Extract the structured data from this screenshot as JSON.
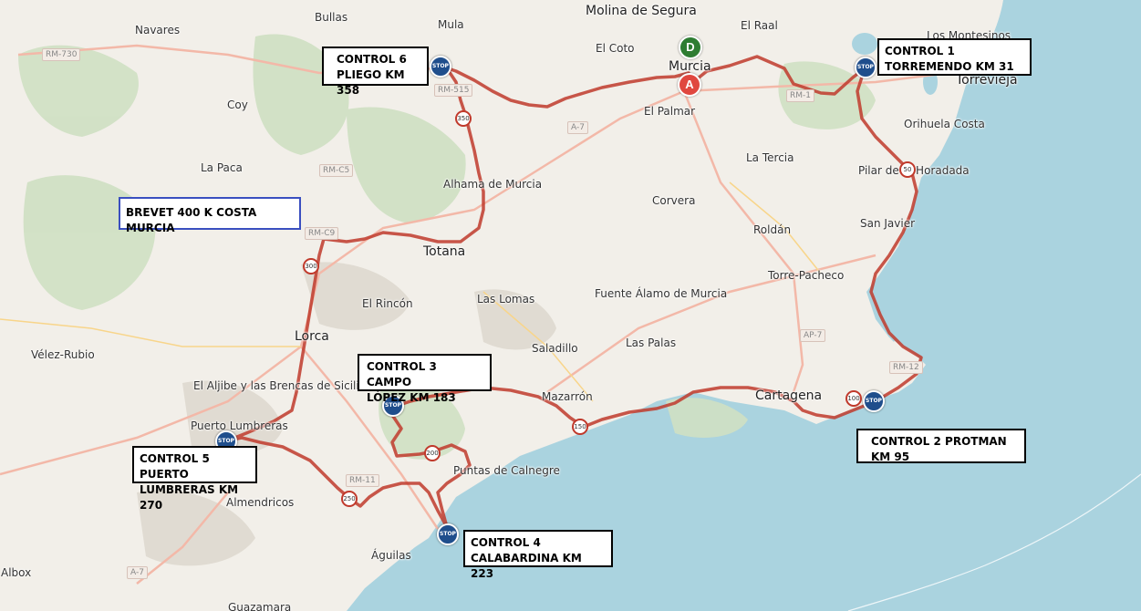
{
  "map_title": "BREVET 400 K COSTA MURCIA",
  "colors": {
    "sea": "#aad3df",
    "land": "#f2efe9",
    "route": "#c0392b",
    "stop": "#1f4e8c",
    "start_pin": "#2e7d32",
    "end_pin": "#e0473f"
  },
  "places": [
    {
      "name": "Bullas",
      "big": false
    },
    {
      "name": "Mula",
      "big": false
    },
    {
      "name": "Molina de Segura",
      "big": true
    },
    {
      "name": "Navares",
      "big": false
    },
    {
      "name": "El Coto",
      "big": false
    },
    {
      "name": "El Raal",
      "big": false
    },
    {
      "name": "Los Montesinos",
      "big": false
    },
    {
      "name": "Murcia",
      "big": true
    },
    {
      "name": "Torrevieja",
      "big": true
    },
    {
      "name": "Coy",
      "big": false
    },
    {
      "name": "El Palmar",
      "big": false
    },
    {
      "name": "Orihuela Costa",
      "big": false
    },
    {
      "name": "La Paca",
      "big": false
    },
    {
      "name": "La Tercia",
      "big": false
    },
    {
      "name": "Pilar de la Horadada",
      "big": false
    },
    {
      "name": "Alhama de Murcia",
      "big": false
    },
    {
      "name": "Corvera",
      "big": false
    },
    {
      "name": "San Javier",
      "big": false
    },
    {
      "name": "Roldán",
      "big": false
    },
    {
      "name": "Totana",
      "big": true
    },
    {
      "name": "Torre-Pacheco",
      "big": false
    },
    {
      "name": "Las Lomas",
      "big": false
    },
    {
      "name": "Fuente Álamo de Murcia",
      "big": false
    },
    {
      "name": "El Rincón",
      "big": false
    },
    {
      "name": "Lorca",
      "big": true
    },
    {
      "name": "Saladillo",
      "big": false
    },
    {
      "name": "Las Palas",
      "big": false
    },
    {
      "name": "Vélez-Rubio",
      "big": false
    },
    {
      "name": "El Aljibe y las Brencas de Sicilia",
      "big": false
    },
    {
      "name": "Mazarrón",
      "big": false
    },
    {
      "name": "Cartagena",
      "big": true
    },
    {
      "name": "Puerto Lumbreras",
      "big": false
    },
    {
      "name": "Puntas de Calnegre",
      "big": false
    },
    {
      "name": "Almendricos",
      "big": false
    },
    {
      "name": "Águilas",
      "big": false
    },
    {
      "name": "Albox",
      "big": false
    },
    {
      "name": "Guazamara",
      "big": false
    }
  ],
  "roads": [
    "RM-730",
    "RM-515",
    "A-7",
    "RM-1",
    "RM-C5",
    "RM-C9",
    "AP-7",
    "RM-12",
    "RM-11",
    "A-7"
  ],
  "km_markers": [
    "350",
    "50",
    "300",
    "100",
    "150",
    "200",
    "250"
  ],
  "stop_label": "STOP",
  "pins": {
    "start": "D",
    "end": "A"
  },
  "controls": [
    {
      "line1": "CONTROL 1",
      "line2": "TORREMENDO KM 31"
    },
    {
      "line1": "CONTROL 2 PROTMAN",
      "line2": "KM 95"
    },
    {
      "line1": "CONTROL 3 CAMPO",
      "line2": "LÓPEZ KM 183"
    },
    {
      "line1": "CONTROL 4",
      "line2": "CALABARDINA KM 223"
    },
    {
      "line1": "CONTROL 5 PUERTO",
      "line2": "LUMBRERAS KM 270"
    },
    {
      "line1": "CONTROL 6",
      "line2": "PLIEGO KM 358"
    }
  ]
}
